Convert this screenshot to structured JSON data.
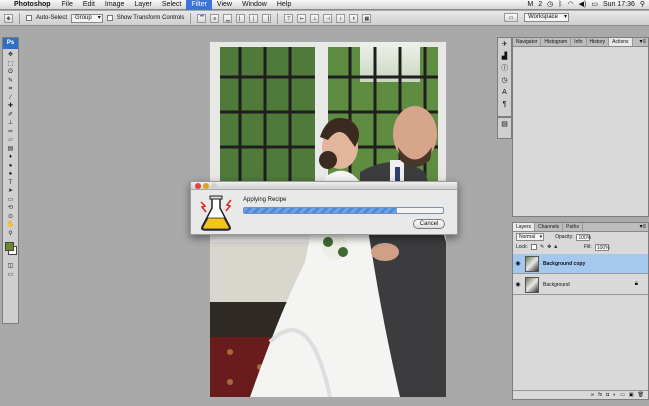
{
  "menubar": {
    "app": "Photoshop",
    "items": [
      "File",
      "Edit",
      "Image",
      "Layer",
      "Select",
      "Filter",
      "View",
      "Window",
      "Help"
    ],
    "active_item": "Filter",
    "badge": "2",
    "clock": "Sun 17:36"
  },
  "options_bar": {
    "auto_select_label": "Auto-Select",
    "auto_select_value": "Group",
    "show_transform_label": "Show Transform Controls",
    "workspace_label": "Workspace"
  },
  "tools": {
    "logo": "Ps",
    "icons": [
      "move-tool",
      "marquee-tool",
      "lasso-tool",
      "quick-select-tool",
      "crop-tool",
      "eyedropper-tool",
      "healing-tool",
      "brush-tool",
      "stamp-tool",
      "history-brush-tool",
      "eraser-tool",
      "gradient-tool",
      "blur-tool",
      "dodge-tool",
      "pen-tool",
      "type-tool",
      "path-select-tool",
      "shape-tool",
      "3d-tool",
      "hand-tool",
      "rotate-view-tool",
      "zoom-tool"
    ],
    "colors": {
      "foreground": "#6b8a2a",
      "background": "#ffffff"
    }
  },
  "nav_panel": {
    "tabs": [
      "Navigator",
      "Histogram",
      "Info",
      "History",
      "Actions"
    ],
    "active_tab": "Actions"
  },
  "layers_panel": {
    "tabs": [
      "Layers",
      "Channels",
      "Paths"
    ],
    "blend_mode": "Normal",
    "opacity_label": "Opacity:",
    "opacity_value": "100%",
    "lock_label": "Lock:",
    "fill_label": "Fill:",
    "fill_value": "100%",
    "layers": [
      {
        "name": "Background copy",
        "selected": true
      },
      {
        "name": "Background",
        "selected": false
      }
    ]
  },
  "dialog": {
    "message": "Applying Recipe",
    "progress": 0.77,
    "cancel_label": "Cancel"
  },
  "colors": {
    "accent": "#3b73d8",
    "progress": "#5b94de",
    "selection": "#a5c8ef"
  }
}
